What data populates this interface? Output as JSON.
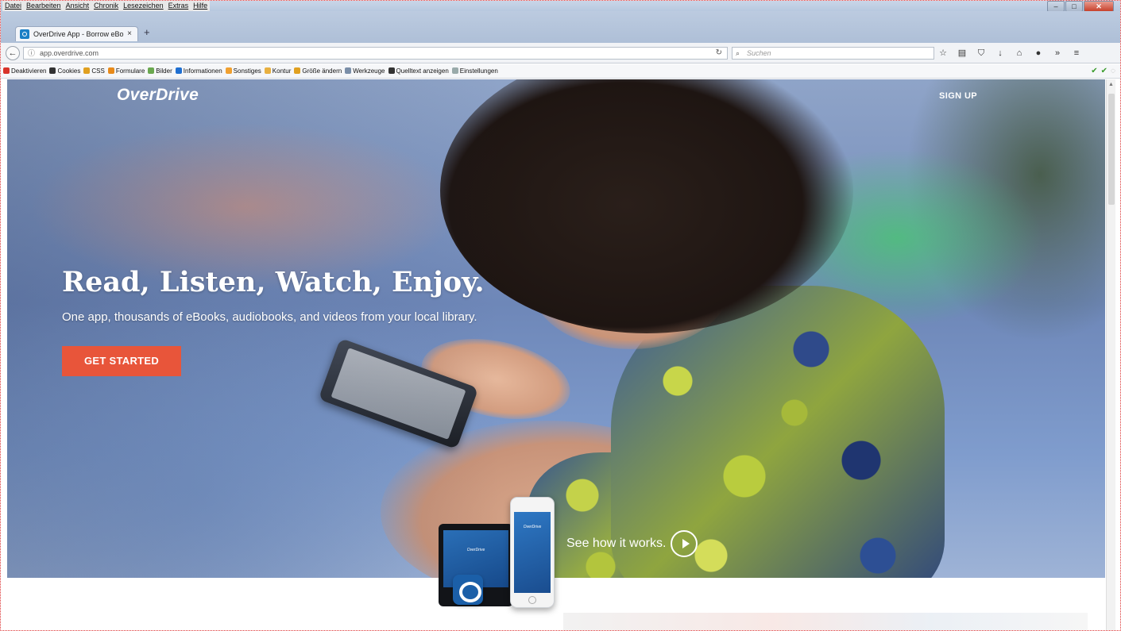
{
  "browser": {
    "menu": [
      "Datei",
      "Bearbeiten",
      "Ansicht",
      "Chronik",
      "Lesezeichen",
      "Extras",
      "Hilfe"
    ],
    "tab_title": "OverDrive App - Borrow eBo",
    "tab_close": "×",
    "new_tab": "+",
    "url": "app.overdrive.com",
    "search_placeholder": "Suchen",
    "toolbar_icons": [
      "star-icon",
      "clipboard-icon",
      "pocket-icon",
      "download-icon",
      "home-icon",
      "extension-icon",
      "menu-icon"
    ],
    "webdev_items": [
      "Deaktivieren",
      "Cookies",
      "CSS",
      "Formulare",
      "Bilder",
      "Informationen",
      "Sonstiges",
      "Kontur",
      "Größe ändern",
      "Werkzeuge",
      "Quelltext anzeigen",
      "Einstellungen"
    ]
  },
  "page": {
    "logo": "OverDrive",
    "signup": "SIGN UP",
    "headline": "Read, Listen, Watch, Enjoy.",
    "subline": "One app, thousands of eBooks, audiobooks, and videos from your local library.",
    "cta": "GET STARTED",
    "see_how": "See how it works.",
    "device_logo": "OverDrive",
    "accent_color": "#e8553a"
  }
}
